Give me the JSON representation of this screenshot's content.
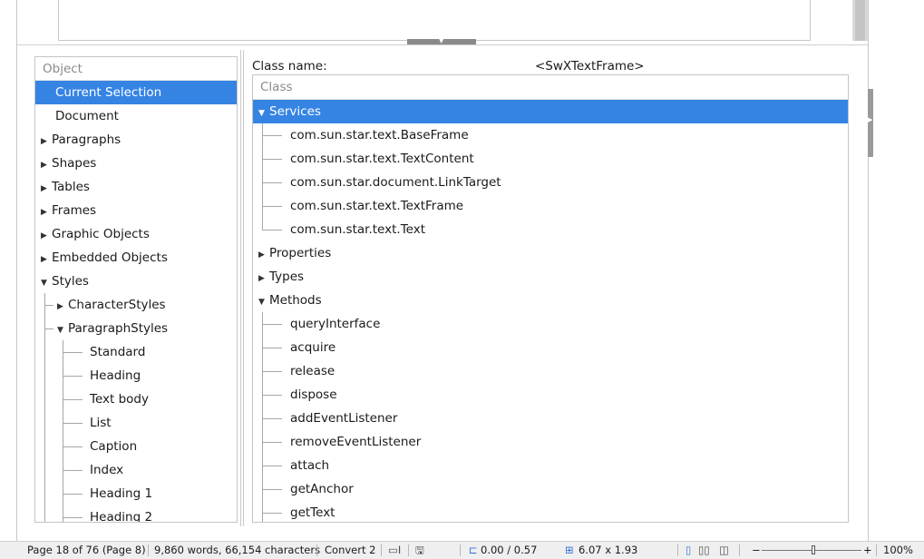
{
  "object_panel": {
    "header": "Object",
    "items": [
      {
        "label": "Current Selection",
        "selected": true
      },
      {
        "label": "Document"
      },
      {
        "label": "Paragraphs",
        "expander": "collapsed"
      },
      {
        "label": "Shapes",
        "expander": "collapsed"
      },
      {
        "label": "Tables",
        "expander": "collapsed"
      },
      {
        "label": "Frames",
        "expander": "collapsed"
      },
      {
        "label": "Graphic Objects",
        "expander": "collapsed"
      },
      {
        "label": "Embedded Objects",
        "expander": "collapsed"
      },
      {
        "label": "Styles",
        "expander": "expanded"
      },
      {
        "label": "CharacterStyles",
        "expander": "collapsed"
      },
      {
        "label": "ParagraphStyles",
        "expander": "expanded"
      },
      {
        "label": "Standard"
      },
      {
        "label": "Heading"
      },
      {
        "label": "Text body"
      },
      {
        "label": "List"
      },
      {
        "label": "Caption"
      },
      {
        "label": "Index"
      },
      {
        "label": "Heading 1"
      },
      {
        "label": "Heading 2"
      }
    ]
  },
  "inspector": {
    "class_name_label": "Class name:",
    "class_name_value": "<SwXTextFrame>",
    "header": "Class",
    "services_label": "Services",
    "services": [
      "com.sun.star.text.BaseFrame",
      "com.sun.star.text.TextContent",
      "com.sun.star.document.LinkTarget",
      "com.sun.star.text.TextFrame",
      "com.sun.star.text.Text"
    ],
    "properties_label": "Properties",
    "types_label": "Types",
    "methods_label": "Methods",
    "methods": [
      "queryInterface",
      "acquire",
      "release",
      "dispose",
      "addEventListener",
      "removeEventListener",
      "attach",
      "getAnchor",
      "getText"
    ]
  },
  "statusbar": {
    "page": "Page 18 of 76 (Page 8)",
    "words": "9,860 words, 66,154 characters",
    "style": "Convert 2",
    "position": "0.00 / 0.57",
    "size": "6.07 x 1.93",
    "zoom_minus": "−",
    "zoom_plus": "+",
    "zoom": "100%",
    "zoom_fraction": 0.5
  },
  "colors": {
    "selection": "#3584e4",
    "window_bg": "#ffffff",
    "statusbar_bg": "#efefef"
  }
}
